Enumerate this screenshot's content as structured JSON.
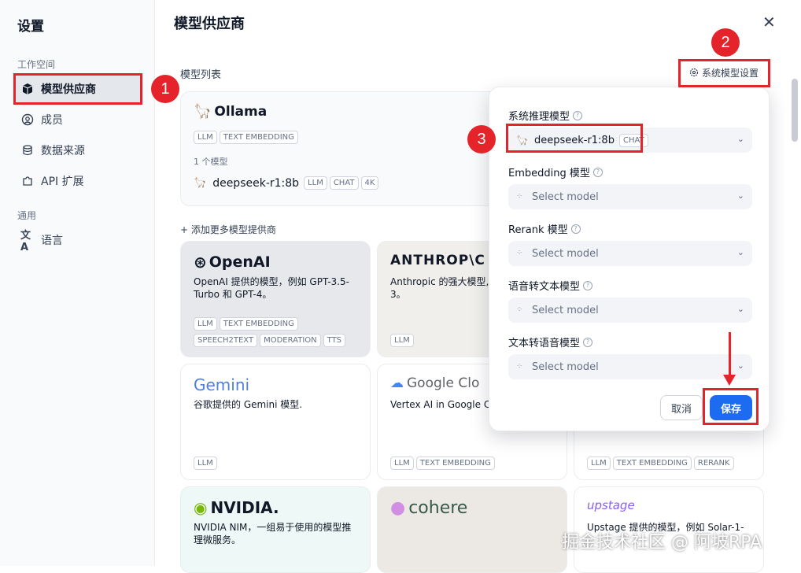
{
  "sidebar": {
    "title": "设置",
    "group_workspace": "工作空间",
    "group_general": "通用",
    "items": [
      {
        "label": "模型供应商",
        "icon": "cube-icon"
      },
      {
        "label": "成员",
        "icon": "user-icon"
      },
      {
        "label": "数据来源",
        "icon": "database-icon"
      },
      {
        "label": "API 扩展",
        "icon": "puzzle-icon"
      },
      {
        "label": "语言",
        "icon": "translate-icon"
      }
    ]
  },
  "main": {
    "title": "模型供应商",
    "section_label": "模型列表",
    "system_settings_button": "系统模型设置",
    "add_more": "+ 添加更多模型提供商"
  },
  "ollama": {
    "name": "Ollama",
    "tags": [
      "LLM",
      "TEXT EMBEDDING"
    ],
    "count": "1 个模型",
    "model": "deepseek-r1:8b",
    "model_tags": [
      "LLM",
      "CHAT",
      "4K"
    ]
  },
  "providers": [
    {
      "name": "OpenAI",
      "desc": "OpenAI 提供的模型，例如 GPT-3.5-Turbo 和 GPT-4。",
      "tags": [
        "LLM",
        "TEXT EMBEDDING",
        "SPEECH2TEXT",
        "MODERATION",
        "TTS"
      ]
    },
    {
      "name": "ANTHROP\\C",
      "desc": "Anthropic 的强大模型,",
      "desc2": "3。",
      "tags": [
        "LLM"
      ]
    },
    {
      "name": "Gemini",
      "desc": "谷歌提供的 Gemini 模型.",
      "tags": [
        "LLM"
      ]
    },
    {
      "name": "Google Clo",
      "desc": "Vertex AI in Google C",
      "tags": [
        "LLM",
        "TEXT EMBEDDING"
      ]
    },
    {
      "name": "",
      "desc": "",
      "tags": [
        "LLM",
        "TEXT EMBEDDING",
        "RERANK"
      ]
    },
    {
      "name": "NVIDIA.",
      "desc": "NVIDIA NIM，一组易于使用的模型推理微服务。",
      "tags": []
    },
    {
      "name": "cohere",
      "desc": "",
      "tags": []
    },
    {
      "name": "upstage",
      "desc": "Upstage 提供的模型，例如 Solar-1-",
      "tags": []
    }
  ],
  "panel": {
    "fields": [
      {
        "label": "系统推理模型",
        "value": "deepseek-r1:8b",
        "badge": "CHAT"
      },
      {
        "label": "Embedding 模型",
        "placeholder": "Select model"
      },
      {
        "label": "Rerank 模型",
        "placeholder": "Select model"
      },
      {
        "label": "语音转文本模型",
        "placeholder": "Select model"
      },
      {
        "label": "文本转语音模型",
        "placeholder": "Select model"
      }
    ],
    "cancel": "取消",
    "save": "保存"
  },
  "annotations": [
    "1",
    "2",
    "3"
  ],
  "watermark": "掘金技术社区 @ 阿坡RPA",
  "colors": {
    "accent": "#1d6bf1",
    "annotation": "#e5232a"
  }
}
